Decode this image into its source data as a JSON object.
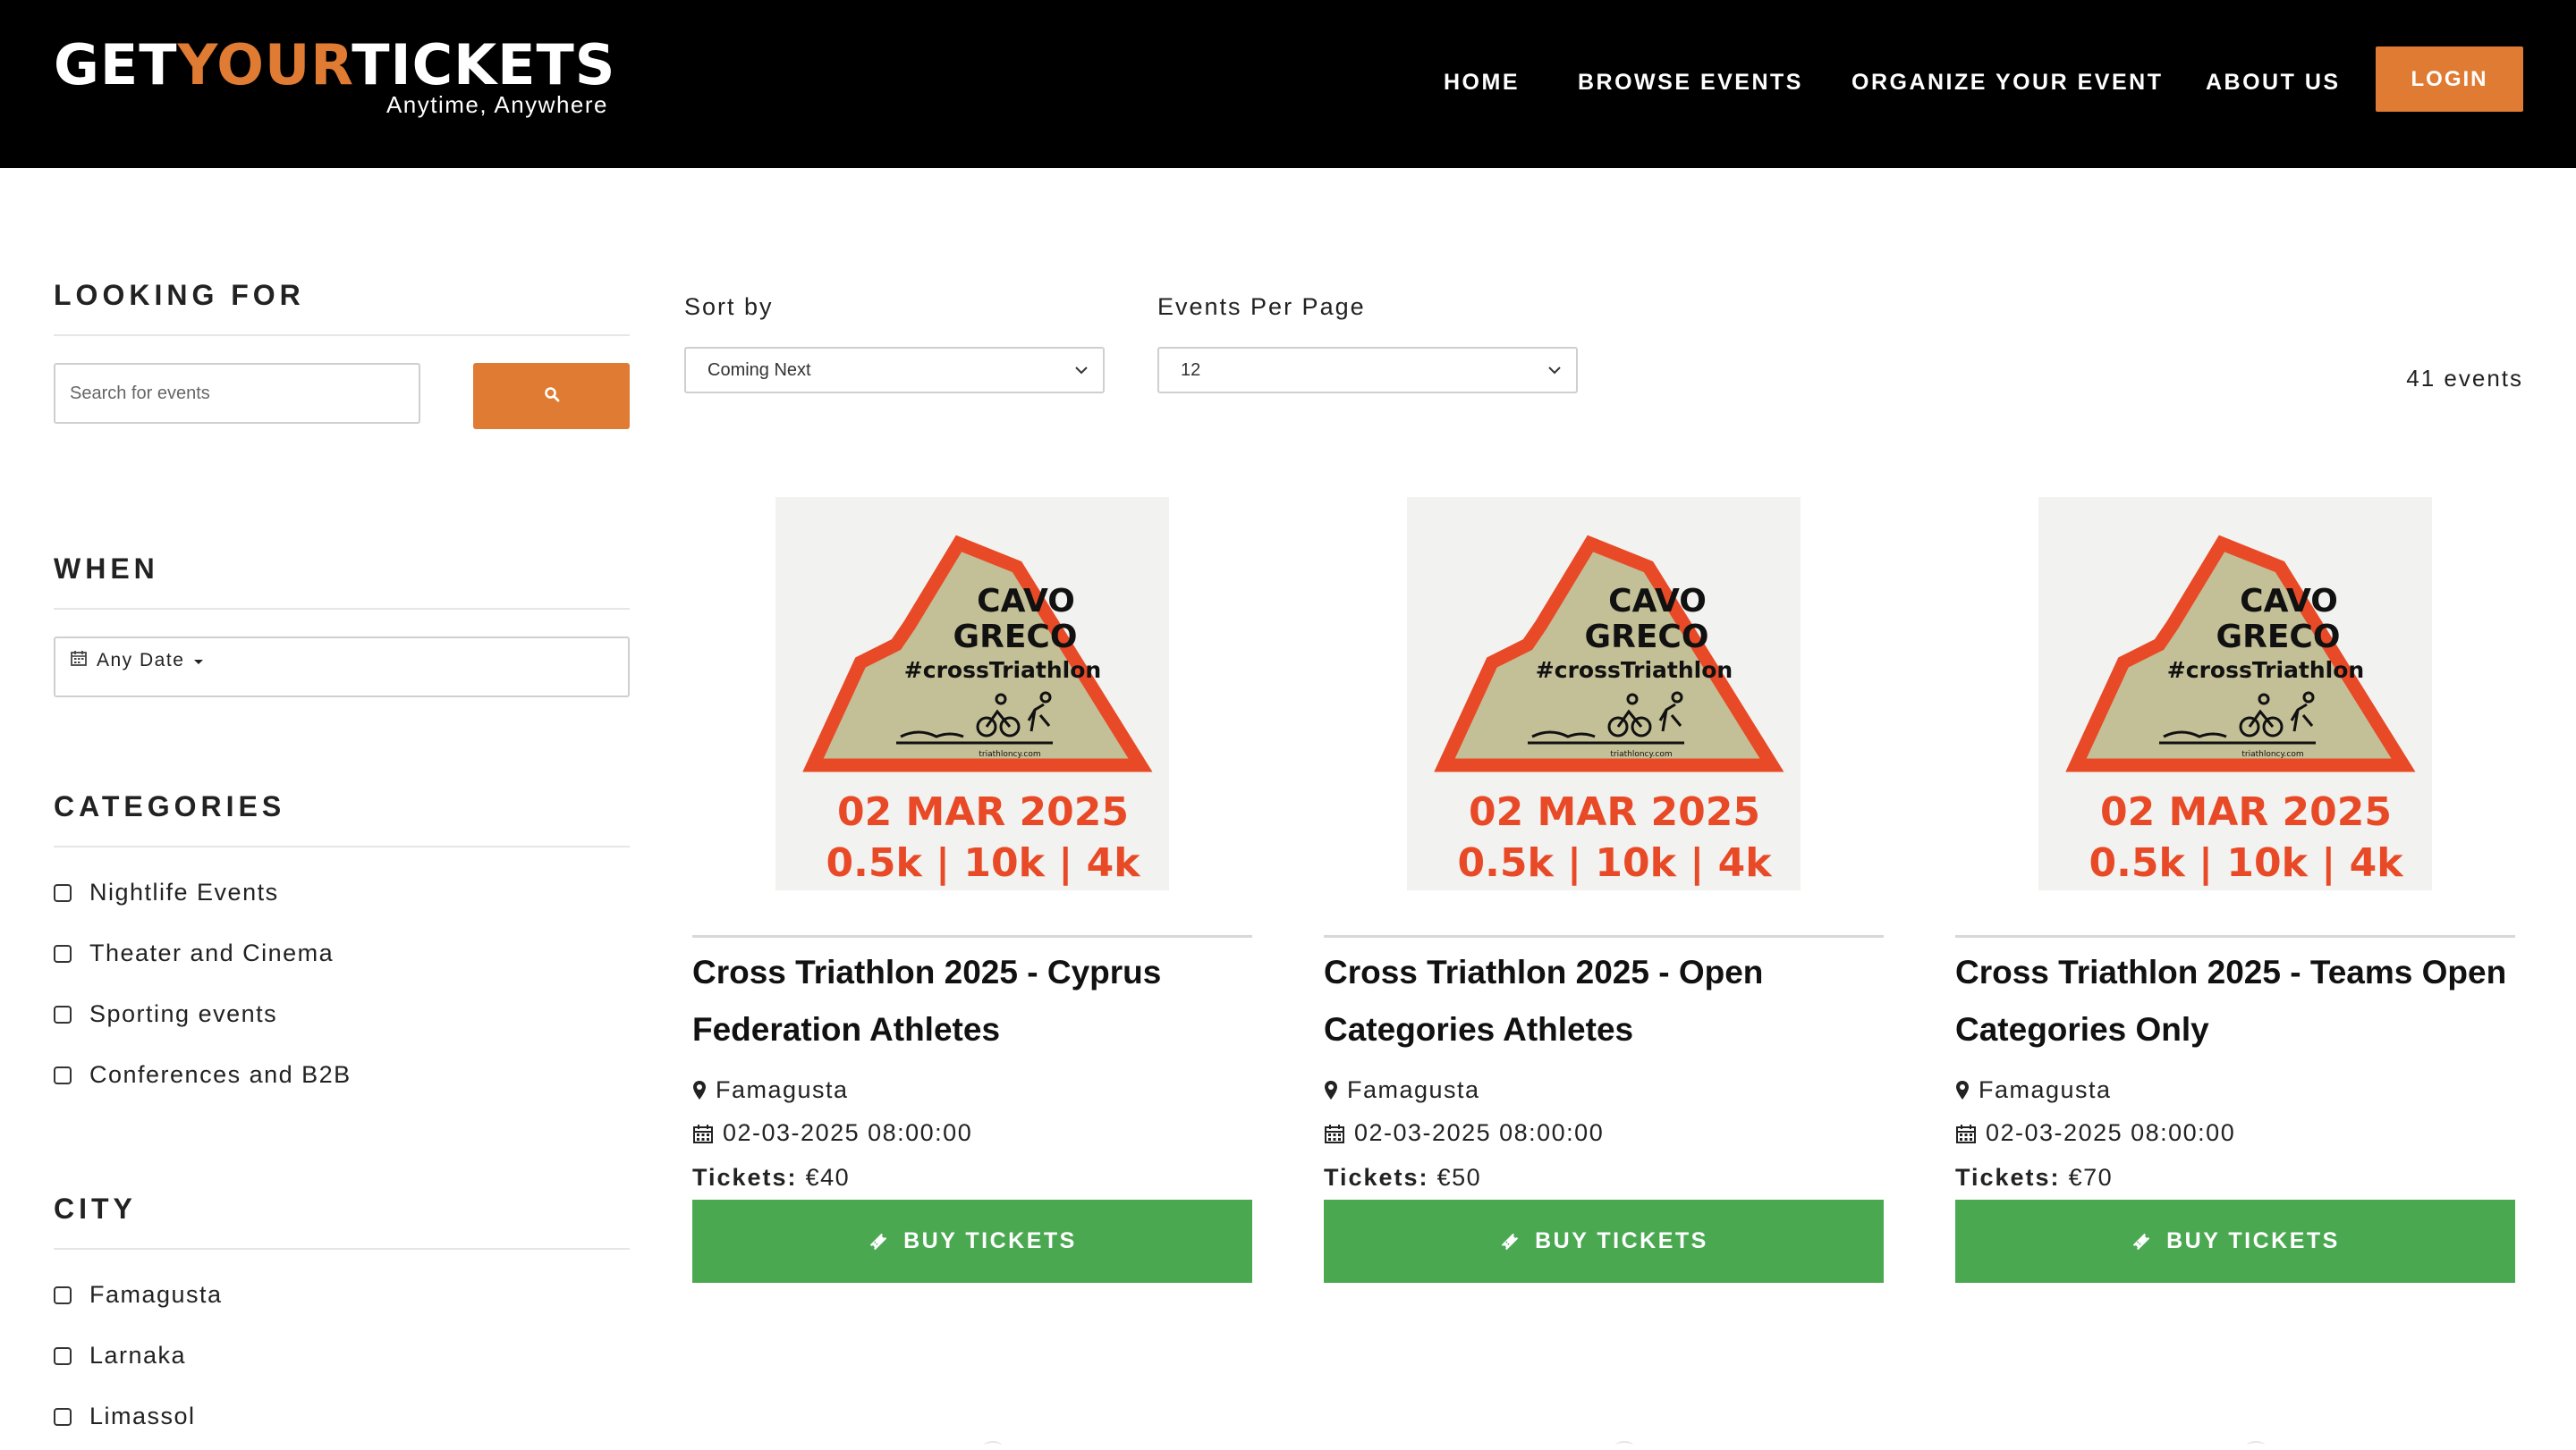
{
  "brand": {
    "logo_part1": "GET",
    "logo_part2": "YOUR",
    "logo_part3": "TICKETS",
    "tagline": "Anytime, Anywhere",
    "accent_color": "#e07b33"
  },
  "nav": {
    "home": "HOME",
    "browse": "BROWSE EVENTS",
    "organize": "ORGANIZE YOUR EVENT",
    "about": "ABOUT US",
    "login": "LOGIN"
  },
  "sidebar": {
    "looking_for": "LOOKING FOR",
    "search_placeholder": "Search for events",
    "search_icon": "search-icon",
    "when": "WHEN",
    "date_label": "Any Date",
    "categories_heading": "CATEGORIES",
    "categories": [
      "Nightlife Events",
      "Theater and Cinema",
      "Sporting events",
      "Conferences and B2B"
    ],
    "city_heading": "CITY",
    "cities": [
      "Famagusta",
      "Larnaka",
      "Limassol"
    ]
  },
  "toolbar": {
    "sort_label": "Sort by",
    "sort_value": "Coming Next",
    "per_page_label": "Events Per Page",
    "per_page_value": "12",
    "events_count": "41 events"
  },
  "poster": {
    "line1": "CAVO",
    "line2": "GRECO",
    "hashtag": "#crossTriathlon",
    "site": "triathloncy.com",
    "date": "02 MAR 2025",
    "distances": "0.5k | 10k | 4k",
    "border_color": "#e84a27",
    "fill_color": "#c3bf96"
  },
  "events": [
    {
      "title": "Cross Triathlon 2025 - Cyprus Federation Athletes",
      "location": "Famagusta",
      "datetime": "02-03-2025 08:00:00",
      "tickets_label": "Tickets:",
      "price": "€40",
      "button": "BUY TICKETS"
    },
    {
      "title": "Cross Triathlon 2025 - Open Categories Athletes",
      "location": "Famagusta",
      "datetime": "02-03-2025 08:00:00",
      "tickets_label": "Tickets:",
      "price": "€50",
      "button": "BUY TICKETS"
    },
    {
      "title": "Cross Triathlon 2025 - Teams Open Categories Only",
      "location": "Famagusta",
      "datetime": "02-03-2025 08:00:00",
      "tickets_label": "Tickets:",
      "price": "€70",
      "button": "BUY TICKETS"
    }
  ]
}
